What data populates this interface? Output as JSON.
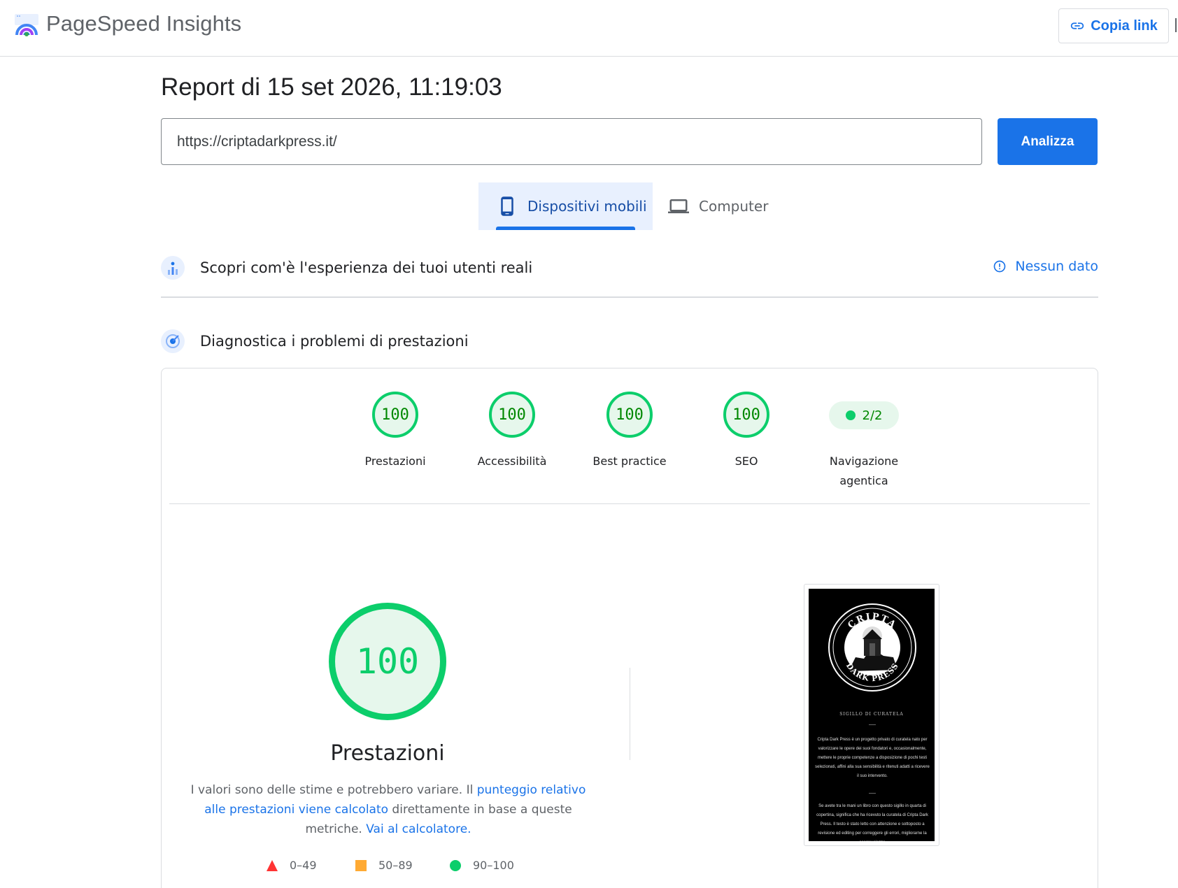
{
  "header": {
    "app_title": "PageSpeed Insights",
    "copy_link_label": "Copia link"
  },
  "report": {
    "title": "Report di 15 set 2026, 11:19:03"
  },
  "search": {
    "url_value": "https://criptadarkpress.it/",
    "analyze_label": "Analizza"
  },
  "device_tabs": [
    {
      "label": "Dispositivi mobili",
      "icon": "smartphone-icon",
      "selected": true
    },
    {
      "label": "Computer",
      "icon": "laptop-icon",
      "selected": false
    }
  ],
  "field_data": {
    "title": "Scopri com'è l'esperienza dei tuoi utenti reali",
    "status": "Nessun dato"
  },
  "lab_data": {
    "title": "Diagnostica i problemi di prestazioni"
  },
  "categories": [
    {
      "score": "100",
      "label": "Prestazioni"
    },
    {
      "score": "100",
      "label": "Accessibilità"
    },
    {
      "score": "100",
      "label": "Best practice"
    },
    {
      "score": "100",
      "label": "SEO"
    }
  ],
  "agentic": {
    "value": "2/2",
    "label_line1": "Navigazione",
    "label_line2": "agentica"
  },
  "performance": {
    "score": "100",
    "title": "Prestazioni",
    "desc_1": "I valori sono delle stime e potrebbero variare. Il ",
    "link_1": "punteggio relativo alle prestazioni viene calcolato",
    "desc_2": " direttamente in base a queste metriche. ",
    "link_2": "Vai al calcolatore."
  },
  "legend": [
    {
      "range": "0–49",
      "shape": "triangle",
      "color": "#ff3333"
    },
    {
      "range": "50–89",
      "shape": "square",
      "color": "#ffaa33"
    },
    {
      "range": "90–100",
      "shape": "circle",
      "color": "#0cce6b"
    }
  ],
  "screenshot": {
    "seal_top": "CRIPTA",
    "seal_bottom": "DARK PRESS",
    "subtitle": "SIGILLO DI CURATELA",
    "para_1": "Cripta Dark Press è un progetto privato di curatela nato per valorizzare le opere dei suoi fondatori e, occasionalmente, mettere le proprie competenze a disposizione di pochi testi selezionati, affini alla sua sensibilità e ritenuti adatti a ricevere il suo intervento.",
    "para_2": "Se avete tra le mani un libro con questo sigillo in quarta di copertina, significa che ha ricevuto la curatela di Cripta Dark Press. Il testo è stato letto con attenzione e sottoposto a revisione ed editing per correggere gli errori, migliorarne la scorrevolezza"
  },
  "colors": {
    "accent": "#1a73e8",
    "pass_green": "#0cce6b",
    "pass_text": "#008800",
    "pass_bg": "#e6f7ec"
  }
}
